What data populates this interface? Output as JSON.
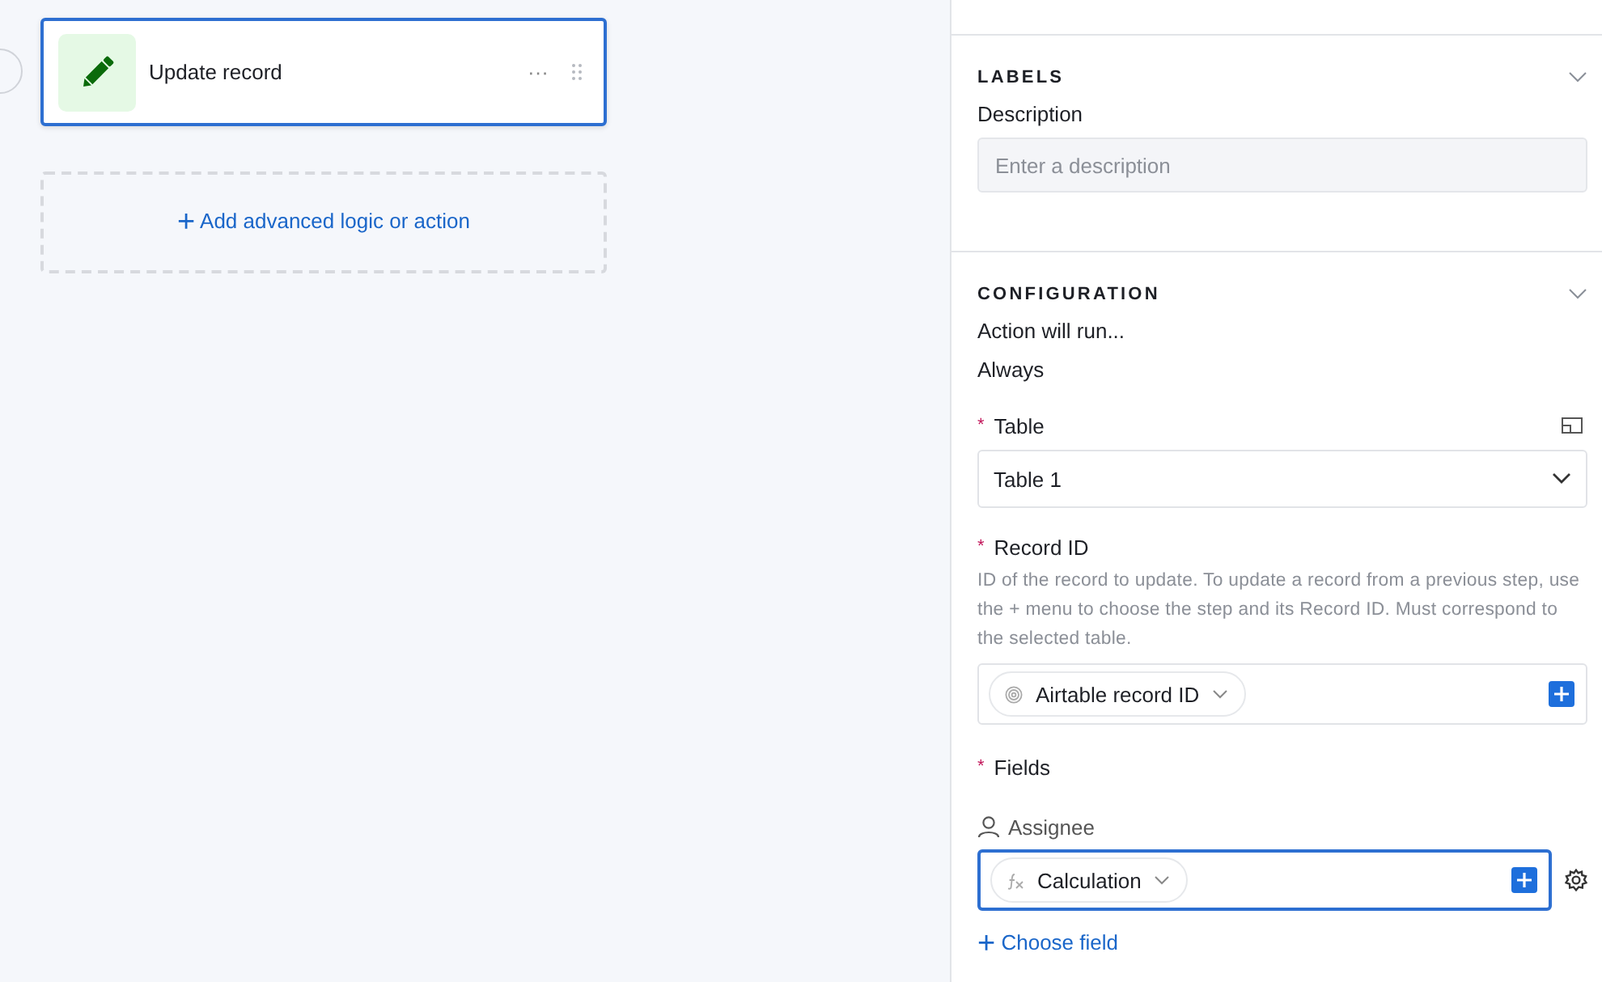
{
  "canvas": {
    "step": {
      "title": "Update record",
      "selected": true,
      "menu": "···"
    },
    "add_action": {
      "icon": "+",
      "label": "Add advanced logic or action"
    }
  },
  "panel": {
    "labels": {
      "heading": "LABELS",
      "expanded": true,
      "description": {
        "label": "Description",
        "placeholder": "Enter a description"
      }
    },
    "configuration": {
      "heading": "CONFIGURATION",
      "expanded": true,
      "run_label": "Action will run...",
      "run_value": "Always",
      "table": {
        "label": "Table",
        "required_mark": "*",
        "value": "Table 1"
      },
      "record_id": {
        "label": "Record ID",
        "required_mark": "*",
        "help": "ID of the record to update. To update a record from a previous step, use the + menu to choose the step and its Record ID. Must correspond to the selected table.",
        "token": "Airtable record ID"
      },
      "fields": {
        "label": "Fields",
        "required_mark": "*",
        "items": [
          {
            "name": "Assignee",
            "token": "Calculation",
            "focused": true
          }
        ]
      },
      "choose_field": {
        "icon": "+",
        "label": "Choose field"
      }
    }
  }
}
